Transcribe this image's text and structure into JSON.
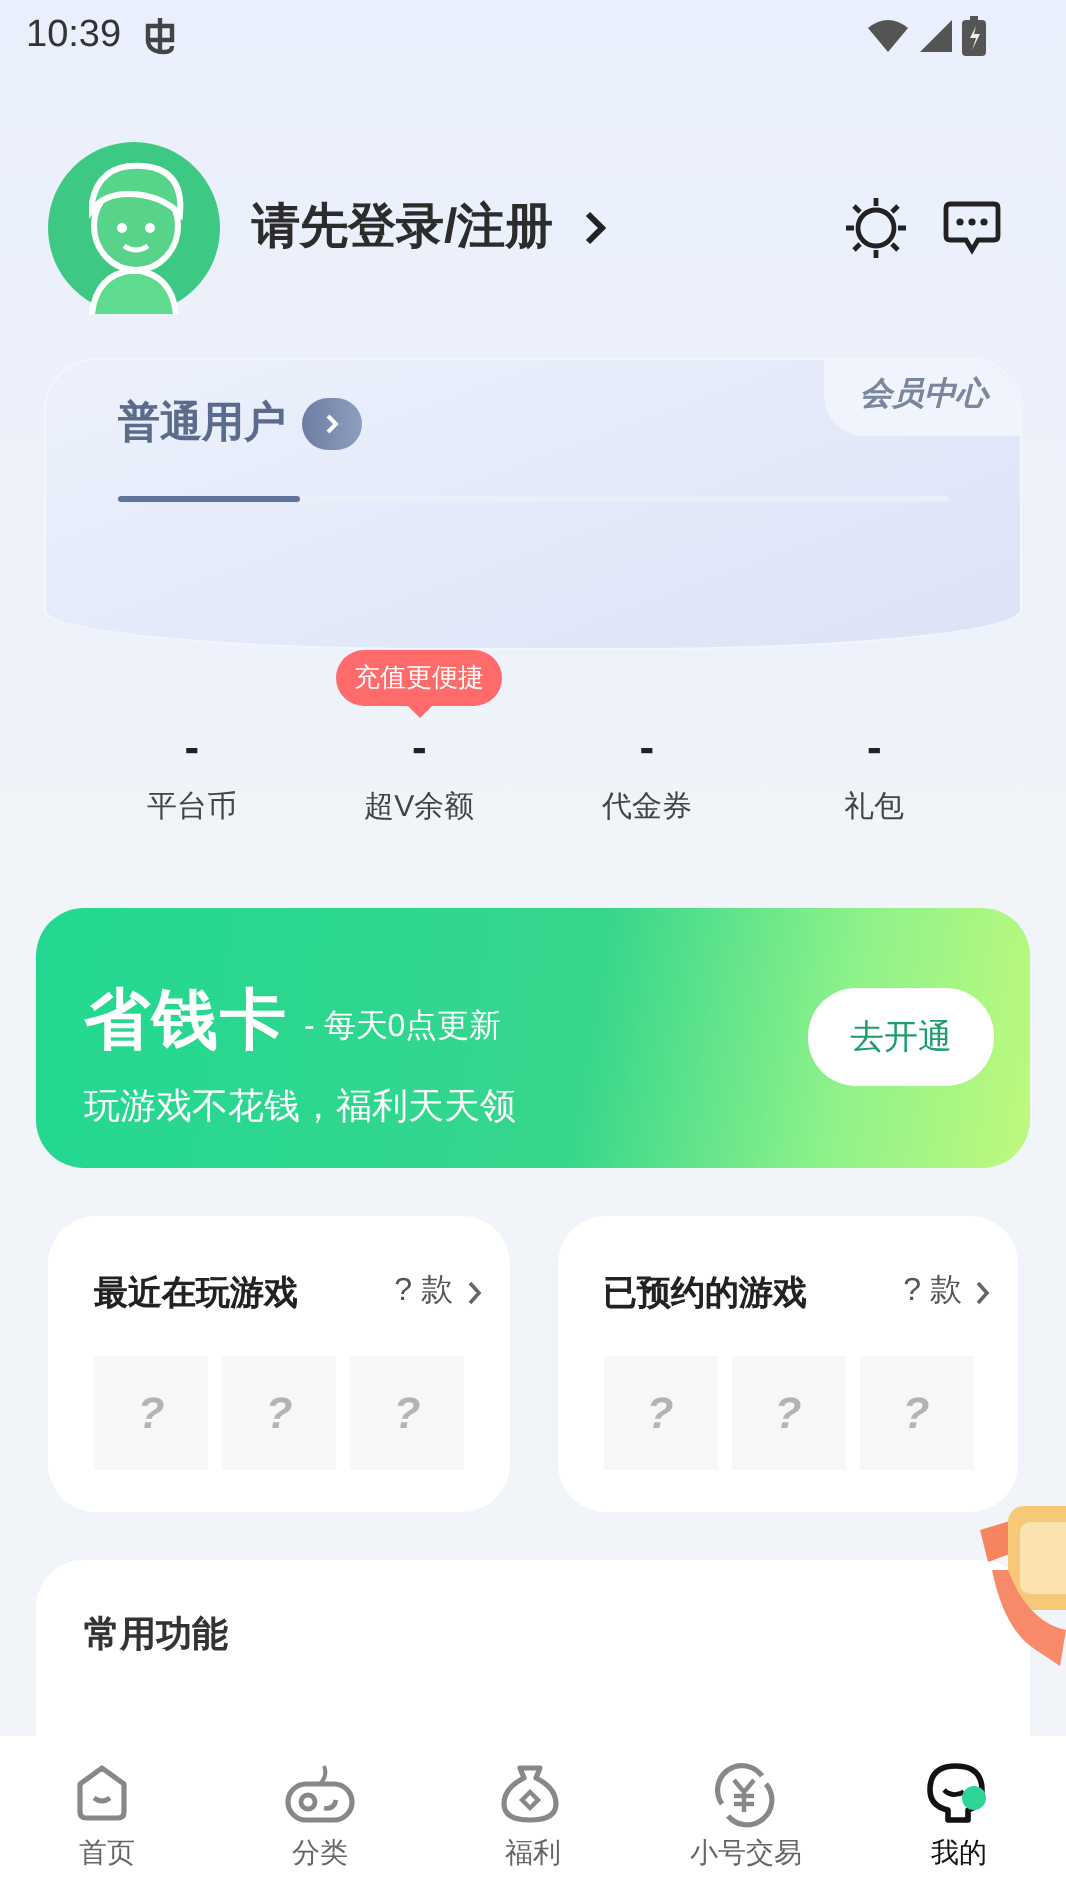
{
  "status_bar": {
    "time": "10:39"
  },
  "profile": {
    "login_text": "请先登录/注册"
  },
  "member_card": {
    "level_name": "普通用户",
    "tab": "会员中心",
    "level": 0.22
  },
  "stats": [
    {
      "value": "-",
      "label": "平台币"
    },
    {
      "value": "-",
      "label": "超V余额",
      "tooltip": "充值更便捷"
    },
    {
      "value": "-",
      "label": "代金券"
    },
    {
      "value": "-",
      "label": "礼包"
    }
  ],
  "promo": {
    "title": "省钱卡",
    "subtitle": "- 每天0点更新",
    "description": "玩游戏不花钱，福利天天领",
    "button": "去开通"
  },
  "game_cards": [
    {
      "title": "最近在玩游戏",
      "count": "?",
      "unit": "款",
      "tiles": [
        "?",
        "?",
        "?"
      ]
    },
    {
      "title": "已预约的游戏",
      "count": "?",
      "unit": "款",
      "tiles": [
        "?",
        "?",
        "?"
      ]
    }
  ],
  "functions": {
    "title": "常用功能"
  },
  "bottom_nav": [
    {
      "label": "首页",
      "kind": "home",
      "selected": false
    },
    {
      "label": "分类",
      "kind": "gamepad",
      "selected": false
    },
    {
      "label": "福利",
      "kind": "bag",
      "selected": false
    },
    {
      "label": "小号交易",
      "kind": "trade",
      "selected": false
    },
    {
      "label": "我的",
      "kind": "me",
      "selected": true
    }
  ]
}
